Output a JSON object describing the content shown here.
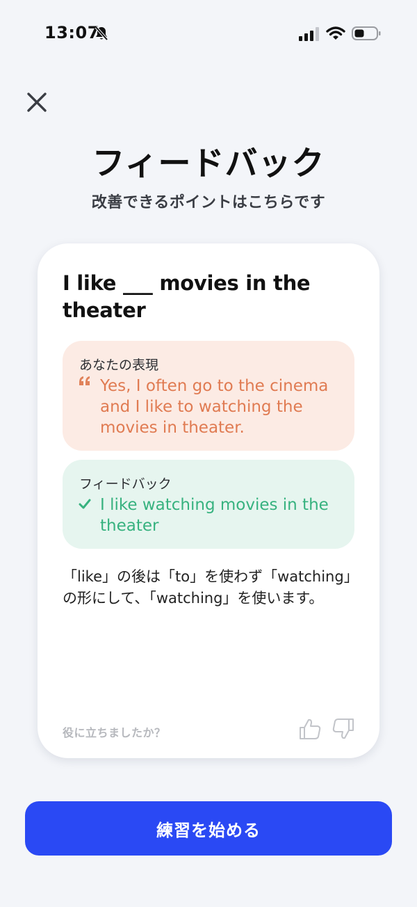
{
  "status_bar": {
    "time": "13:07"
  },
  "header": {
    "title": "フィードバック",
    "subtitle": "改善できるポイントはこちらです"
  },
  "card": {
    "question": "I like ___ movies in the theater",
    "user_expression": {
      "label": "あなたの表現",
      "text": "Yes, I often go to the cinema and I like to watching the movies in theater."
    },
    "feedback": {
      "label": "フィードバック",
      "text": "I like watching movies in the theater"
    },
    "explanation": "「like」の後は「to」を使わず「watching」の形にして、「watching」を使います。",
    "helpful_prompt": "役に立ちましたか？"
  },
  "start_button": {
    "label": "練習を始める"
  },
  "colors": {
    "background": "#f3f5f9",
    "accent": "#2a49f4",
    "user_box_bg": "#fcebe4",
    "user_text": "#e07b52",
    "feedback_box_bg": "#e6f5ef",
    "feedback_text": "#37b27f"
  },
  "icons": {
    "bell": "bell-slash-icon",
    "signal": "cellular-signal-icon",
    "wifi": "wifi-icon",
    "battery": "battery-icon",
    "close": "close-icon",
    "quote": "quote-icon",
    "check": "check-icon",
    "thumb_up": "thumbs-up-icon",
    "thumb_down": "thumbs-down-icon"
  }
}
